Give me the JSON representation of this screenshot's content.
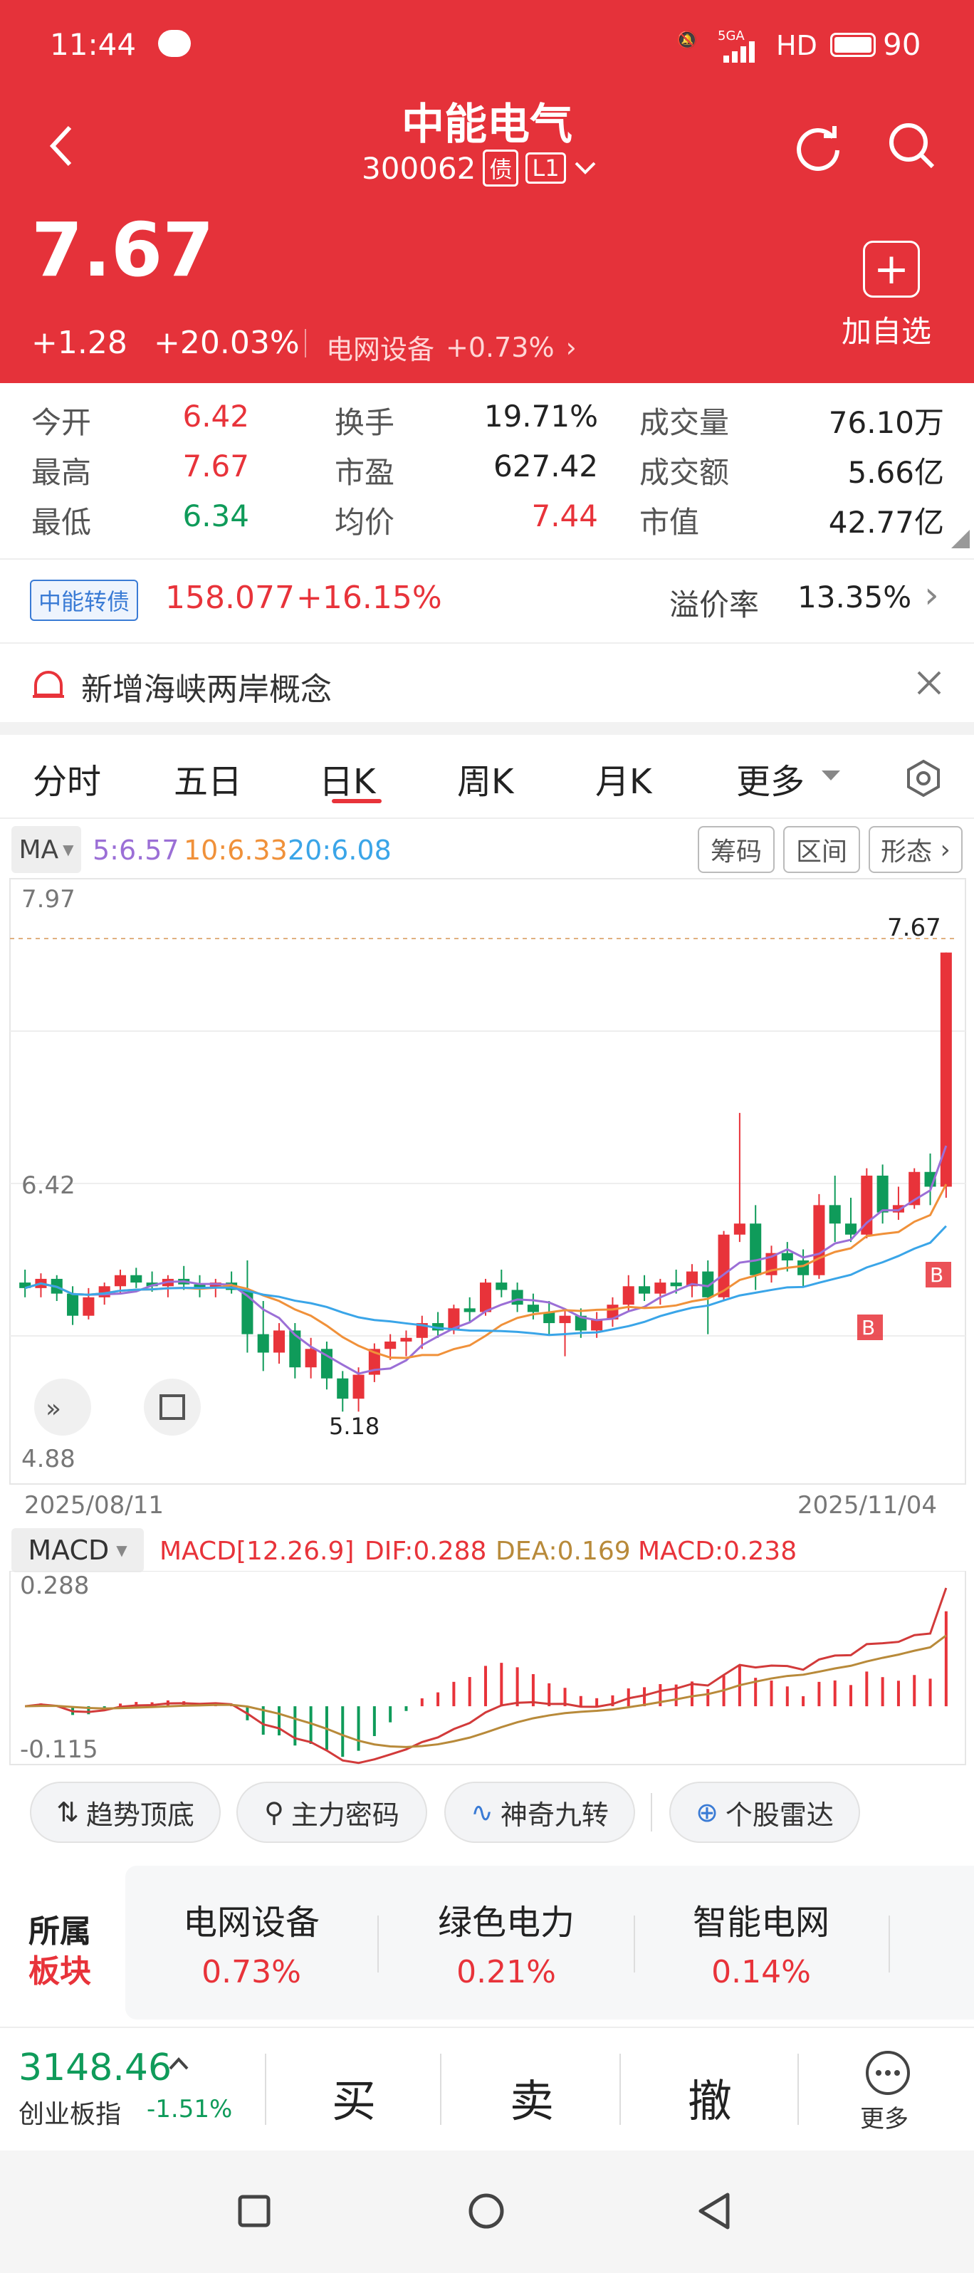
{
  "status_bar": {
    "time": "11:44",
    "network": "5GA",
    "hd": "HD",
    "battery": "90"
  },
  "header": {
    "stock_name": "中能电气",
    "code": "300062",
    "badge_bond": "债",
    "badge_level": "L1",
    "price": "7.67",
    "change": "+1.28",
    "change_pct": "+20.03%",
    "sector": "电网设备",
    "sector_pct": "+0.73%",
    "add_label": "加自选"
  },
  "stats": [
    {
      "label": "今开",
      "value": "6.42",
      "color": "#e8333a"
    },
    {
      "label": "换手",
      "value": "19.71%",
      "color": "#222222"
    },
    {
      "label": "成交量",
      "value": "76.10万",
      "color": "#222222"
    },
    {
      "label": "最高",
      "value": "7.67",
      "color": "#e8333a"
    },
    {
      "label": "市盈",
      "value": "627.42",
      "color": "#222222"
    },
    {
      "label": "成交额",
      "value": "5.66亿",
      "color": "#222222"
    },
    {
      "label": "最低",
      "value": "6.34",
      "color": "#0f9b5a"
    },
    {
      "label": "均价",
      "value": "7.44",
      "color": "#e8333a"
    },
    {
      "label": "市值",
      "value": "42.77亿",
      "color": "#222222"
    }
  ],
  "bond": {
    "tag": "中能转债",
    "price": "158.077",
    "pct": "+16.15%",
    "premium_label": "溢价率",
    "premium": "13.35%"
  },
  "notice": {
    "text": "新增海峡两岸概念"
  },
  "tabs": [
    "分时",
    "五日",
    "日K",
    "周K",
    "月K",
    "更多"
  ],
  "active_tab": "日K",
  "ma": {
    "label": "MA",
    "ma5": "5:6.57",
    "ma10": "10:6.33",
    "ma20": "20:6.08",
    "btn1": "筹码",
    "btn2": "区间",
    "btn3": "形态"
  },
  "colors": {
    "up": "#e8333a",
    "down": "#0f9b5a",
    "ma5": "#9b6fd6",
    "ma10": "#f0913a",
    "ma20": "#3aa5e8",
    "header": "#e5323a"
  },
  "chart_data": {
    "type": "candlestick",
    "y_labels": {
      "top": "7.97",
      "mid": "6.42",
      "bottom": "4.88"
    },
    "ylim": [
      4.88,
      7.97
    ],
    "last_price_label": "7.67",
    "low_label": "5.18",
    "x_start": "2025/08/11",
    "x_end": "2025/11/04",
    "candles": [
      {
        "o": 5.88,
        "h": 5.95,
        "l": 5.8,
        "c": 5.85
      },
      {
        "o": 5.85,
        "h": 5.93,
        "l": 5.8,
        "c": 5.9
      },
      {
        "o": 5.9,
        "h": 5.92,
        "l": 5.78,
        "c": 5.82
      },
      {
        "o": 5.82,
        "h": 5.86,
        "l": 5.65,
        "c": 5.7
      },
      {
        "o": 5.7,
        "h": 5.85,
        "l": 5.68,
        "c": 5.8
      },
      {
        "o": 5.8,
        "h": 5.88,
        "l": 5.76,
        "c": 5.86
      },
      {
        "o": 5.86,
        "h": 5.95,
        "l": 5.82,
        "c": 5.92
      },
      {
        "o": 5.92,
        "h": 5.96,
        "l": 5.85,
        "c": 5.88
      },
      {
        "o": 5.88,
        "h": 5.94,
        "l": 5.83,
        "c": 5.86
      },
      {
        "o": 5.86,
        "h": 5.92,
        "l": 5.8,
        "c": 5.9
      },
      {
        "o": 5.9,
        "h": 5.97,
        "l": 5.84,
        "c": 5.87
      },
      {
        "o": 5.87,
        "h": 5.92,
        "l": 5.8,
        "c": 5.85
      },
      {
        "o": 5.85,
        "h": 5.9,
        "l": 5.8,
        "c": 5.88
      },
      {
        "o": 5.88,
        "h": 5.94,
        "l": 5.82,
        "c": 5.84
      },
      {
        "o": 5.84,
        "h": 6.0,
        "l": 5.5,
        "c": 5.6
      },
      {
        "o": 5.6,
        "h": 5.78,
        "l": 5.4,
        "c": 5.5
      },
      {
        "o": 5.5,
        "h": 5.66,
        "l": 5.44,
        "c": 5.62
      },
      {
        "o": 5.62,
        "h": 5.66,
        "l": 5.36,
        "c": 5.42
      },
      {
        "o": 5.42,
        "h": 5.58,
        "l": 5.36,
        "c": 5.52
      },
      {
        "o": 5.52,
        "h": 5.56,
        "l": 5.3,
        "c": 5.36
      },
      {
        "o": 5.36,
        "h": 5.4,
        "l": 5.18,
        "c": 5.25
      },
      {
        "o": 5.25,
        "h": 5.42,
        "l": 5.18,
        "c": 5.38
      },
      {
        "o": 5.38,
        "h": 5.55,
        "l": 5.34,
        "c": 5.52
      },
      {
        "o": 5.52,
        "h": 5.6,
        "l": 5.46,
        "c": 5.56
      },
      {
        "o": 5.56,
        "h": 5.62,
        "l": 5.48,
        "c": 5.58
      },
      {
        "o": 5.58,
        "h": 5.7,
        "l": 5.52,
        "c": 5.66
      },
      {
        "o": 5.66,
        "h": 5.72,
        "l": 5.58,
        "c": 5.62
      },
      {
        "o": 5.62,
        "h": 5.76,
        "l": 5.6,
        "c": 5.74
      },
      {
        "o": 5.74,
        "h": 5.8,
        "l": 5.66,
        "c": 5.72
      },
      {
        "o": 5.72,
        "h": 5.9,
        "l": 5.7,
        "c": 5.88
      },
      {
        "o": 5.88,
        "h": 5.95,
        "l": 5.8,
        "c": 5.84
      },
      {
        "o": 5.84,
        "h": 5.88,
        "l": 5.72,
        "c": 5.76
      },
      {
        "o": 5.76,
        "h": 5.82,
        "l": 5.68,
        "c": 5.72
      },
      {
        "o": 5.72,
        "h": 5.78,
        "l": 5.6,
        "c": 5.66
      },
      {
        "o": 5.66,
        "h": 5.74,
        "l": 5.48,
        "c": 5.7
      },
      {
        "o": 5.7,
        "h": 5.74,
        "l": 5.58,
        "c": 5.62
      },
      {
        "o": 5.62,
        "h": 5.72,
        "l": 5.58,
        "c": 5.68
      },
      {
        "o": 5.68,
        "h": 5.8,
        "l": 5.64,
        "c": 5.76
      },
      {
        "o": 5.76,
        "h": 5.92,
        "l": 5.72,
        "c": 5.86
      },
      {
        "o": 5.86,
        "h": 5.92,
        "l": 5.78,
        "c": 5.82
      },
      {
        "o": 5.82,
        "h": 5.9,
        "l": 5.76,
        "c": 5.88
      },
      {
        "o": 5.88,
        "h": 5.95,
        "l": 5.82,
        "c": 5.86
      },
      {
        "o": 5.86,
        "h": 5.98,
        "l": 5.8,
        "c": 5.94
      },
      {
        "o": 5.94,
        "h": 6.0,
        "l": 5.6,
        "c": 5.8
      },
      {
        "o": 5.8,
        "h": 6.16,
        "l": 5.78,
        "c": 6.14
      },
      {
        "o": 6.14,
        "h": 6.8,
        "l": 6.1,
        "c": 6.2
      },
      {
        "o": 6.2,
        "h": 6.3,
        "l": 5.84,
        "c": 5.92
      },
      {
        "o": 5.92,
        "h": 6.08,
        "l": 5.88,
        "c": 6.04
      },
      {
        "o": 6.04,
        "h": 6.1,
        "l": 5.94,
        "c": 6.0
      },
      {
        "o": 6.0,
        "h": 6.06,
        "l": 5.86,
        "c": 5.92
      },
      {
        "o": 5.92,
        "h": 6.36,
        "l": 5.9,
        "c": 6.3
      },
      {
        "o": 6.3,
        "h": 6.46,
        "l": 6.1,
        "c": 6.2
      },
      {
        "o": 6.2,
        "h": 6.34,
        "l": 6.1,
        "c": 6.14
      },
      {
        "o": 6.14,
        "h": 6.5,
        "l": 6.12,
        "c": 6.46
      },
      {
        "o": 6.46,
        "h": 6.52,
        "l": 6.2,
        "c": 6.26
      },
      {
        "o": 6.26,
        "h": 6.4,
        "l": 6.22,
        "c": 6.3
      },
      {
        "o": 6.3,
        "h": 6.5,
        "l": 6.28,
        "c": 6.48
      },
      {
        "o": 6.48,
        "h": 6.58,
        "l": 6.3,
        "c": 6.4
      },
      {
        "o": 6.4,
        "h": 7.67,
        "l": 6.34,
        "c": 7.67
      }
    ],
    "ma5_text": "5:6.57",
    "ma10_text": "10:6.33",
    "ma20_text": "20:6.08"
  },
  "macd": {
    "label": "MACD",
    "params": "MACD[12.26.9]",
    "dif": "DIF:0.288",
    "dea": "DEA:0.169",
    "macd": "MACD:0.238",
    "top": "0.288",
    "bottom": "-0.115"
  },
  "tools": [
    {
      "icon": "trend-icon",
      "label": "趋势顶底"
    },
    {
      "icon": "key-icon",
      "label": "主力密码"
    },
    {
      "icon": "nine-turn-icon",
      "label": "神奇九转"
    },
    {
      "icon": "radar-icon",
      "label": "个股雷达"
    }
  ],
  "sectors": {
    "title1": "所属",
    "title2": "板块",
    "items": [
      {
        "name": "电网设备",
        "pct": "0.73%"
      },
      {
        "name": "绿色电力",
        "pct": "0.21%"
      },
      {
        "name": "智能电网",
        "pct": "0.14%"
      }
    ]
  },
  "bottom": {
    "index_value": "3148.46",
    "index_name": "创业板指",
    "index_pct": "-1.51%",
    "buy": "买",
    "sell": "卖",
    "cancel": "撤",
    "more": "更多"
  }
}
